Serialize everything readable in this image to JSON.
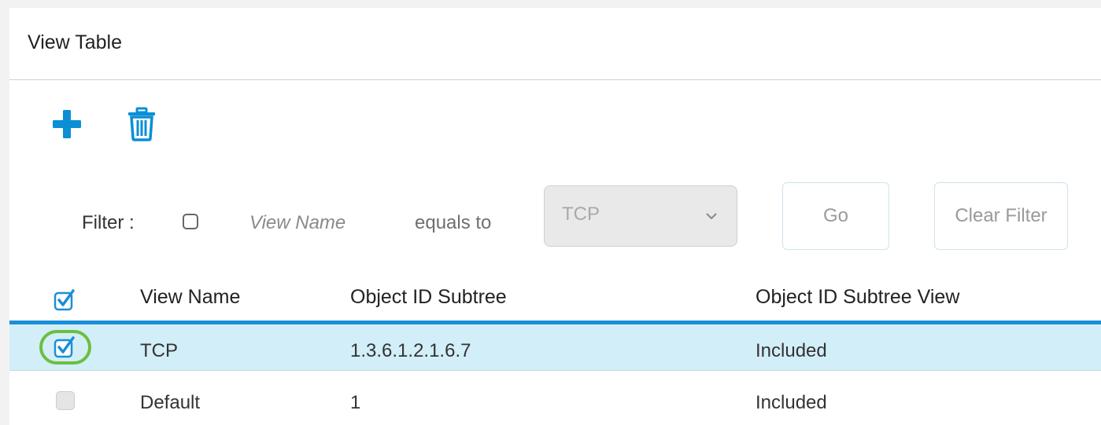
{
  "panel": {
    "title": "View Table"
  },
  "toolbar": {
    "add_icon": "plus-icon",
    "delete_icon": "trash-icon",
    "accent_color": "#0a8fd6"
  },
  "filter": {
    "label": "Filter :",
    "enabled": false,
    "field": "View Name",
    "operator": "equals to",
    "select_value": "TCP",
    "go_label": "Go",
    "clear_label": "Clear Filter"
  },
  "table": {
    "header_checked": true,
    "columns": [
      "View Name",
      "Object ID Subtree",
      "Object ID Subtree View"
    ],
    "rows": [
      {
        "selected": true,
        "view_name": "TCP",
        "object_id_subtree": "1.3.6.1.2.1.6.7",
        "subtree_view": "Included"
      },
      {
        "selected": false,
        "view_name": "Default",
        "object_id_subtree": "1",
        "subtree_view": "Included"
      }
    ],
    "selected_row_color": "#d2eef8",
    "highlight_color": "#6cbf3e"
  }
}
